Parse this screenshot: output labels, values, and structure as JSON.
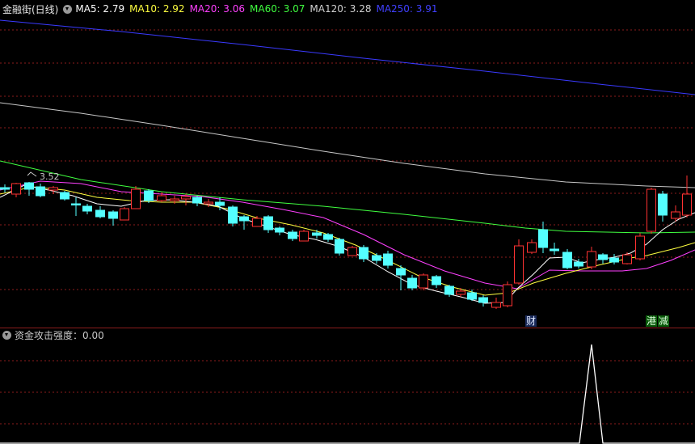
{
  "header": {
    "stock_name": "金融街(日线)",
    "ma": [
      {
        "label": "MA5: 2.79",
        "color": "#ffffff"
      },
      {
        "label": "MA10: 2.92",
        "color": "#ffff40"
      },
      {
        "label": "MA20: 3.06",
        "color": "#ff40ff"
      },
      {
        "label": "MA60: 3.07",
        "color": "#40ff40"
      },
      {
        "label": "MA120: 3.28",
        "color": "#d0d0d0"
      },
      {
        "label": "MA250: 3.91",
        "color": "#4040ff"
      }
    ]
  },
  "price_marker": "3.52",
  "event_tags": [
    {
      "text": "财",
      "bg": "#1a2a5a",
      "color": "#dfe8ff"
    },
    {
      "text": "港",
      "bg": "#0a5a0a",
      "color": "#dfffdf"
    },
    {
      "text": "减",
      "bg": "#0a5a0a",
      "color": "#dfffdf"
    }
  ],
  "sub_indicator": {
    "label": "资金攻击强度：0.00"
  },
  "colors": {
    "up": "#ff3232",
    "down": "#54ffff",
    "grid": "#8b1d1d",
    "ma5": "#ffffff",
    "ma10": "#ffff40",
    "ma20": "#ff40ff",
    "ma60": "#40ff40",
    "ma120": "#c8c8c8",
    "ma250": "#3a3aff",
    "sub_line": "#ffffff"
  }
}
